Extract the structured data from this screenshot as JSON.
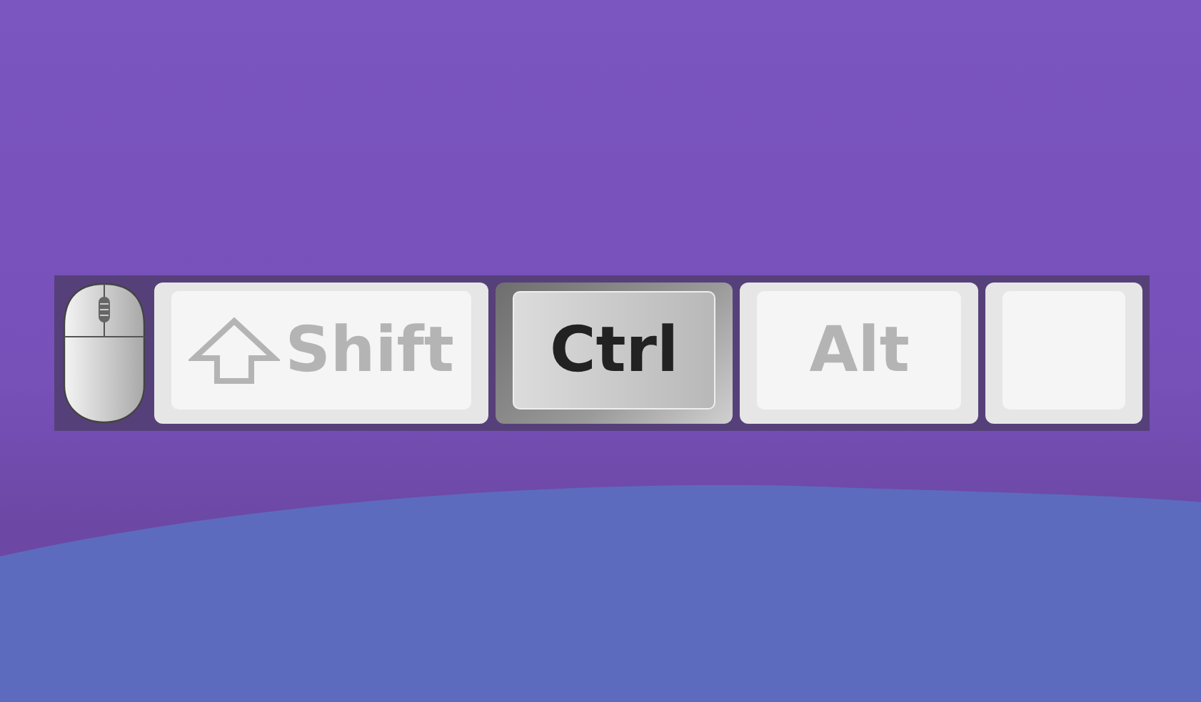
{
  "keys": [
    {
      "kind": "arrow",
      "label": "Shift",
      "pressed": false
    },
    {
      "kind": "plain",
      "label": "Ctrl",
      "pressed": true
    },
    {
      "kind": "plain",
      "label": "Alt",
      "pressed": false
    },
    {
      "kind": "blank",
      "pressed": false
    }
  ]
}
